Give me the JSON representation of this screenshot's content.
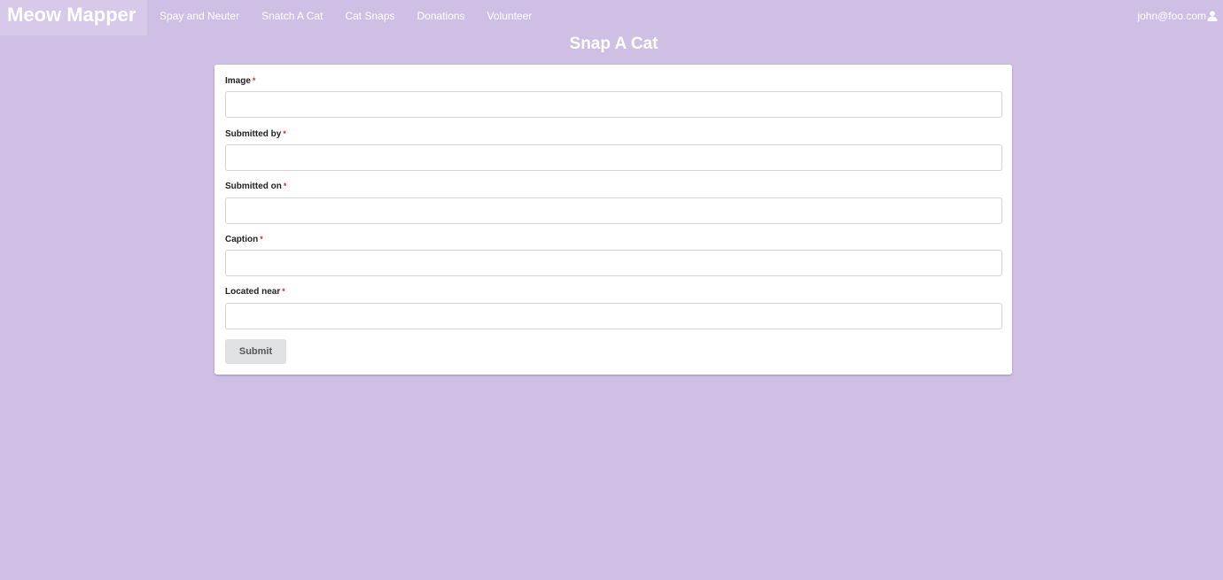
{
  "app": {
    "brand": "Meow Mapper"
  },
  "nav": {
    "items": [
      {
        "label": "Spay and Neuter"
      },
      {
        "label": "Snatch A Cat"
      },
      {
        "label": "Cat Snaps"
      },
      {
        "label": "Donations"
      },
      {
        "label": "Volunteer"
      }
    ],
    "user_email": "john@foo.com",
    "user_icon": "user-icon"
  },
  "page": {
    "title": "Snap A Cat"
  },
  "form": {
    "required_marker": "*",
    "fields": [
      {
        "label": "Image",
        "value": ""
      },
      {
        "label": "Submitted by",
        "value": ""
      },
      {
        "label": "Submitted on",
        "value": ""
      },
      {
        "label": "Caption",
        "value": ""
      },
      {
        "label": "Located near",
        "value": ""
      }
    ],
    "submit_label": "Submit"
  },
  "colors": {
    "background": "#cfbfe5",
    "brand_background": "#d7c9ea",
    "required": "#db2828",
    "button": "#e0e1e2"
  }
}
